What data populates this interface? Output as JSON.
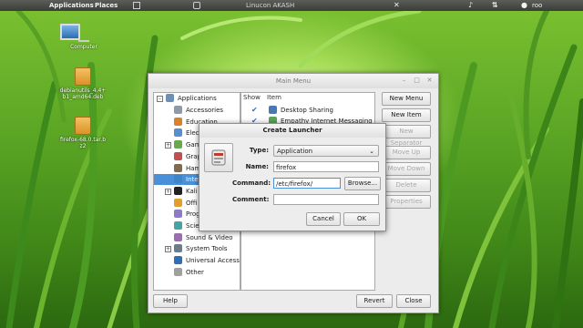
{
  "top_panel": {
    "applications": "Applications",
    "places": "Places",
    "window_title": "Linucon AKASH",
    "user": "roo"
  },
  "desktop": {
    "icons": [
      {
        "label": "Computer",
        "icon": "computer-icon"
      },
      {
        "label": "debianutils_4.4+b1_amd64.deb",
        "icon": "package-icon"
      },
      {
        "label": "firefox-68.0.tar.bz2",
        "icon": "archive-icon"
      }
    ]
  },
  "main_menu": {
    "title": "Main Menu",
    "categories_header": "Applications",
    "categories": [
      {
        "label": "Accessories",
        "color": "#8e9aa6"
      },
      {
        "label": "Education",
        "color": "#d9822b"
      },
      {
        "label": "Elec",
        "color": "#5a8fcf"
      },
      {
        "label": "Gam",
        "color": "#6aa84f"
      },
      {
        "label": "Grap",
        "color": "#c0504d"
      },
      {
        "label": "Ham",
        "color": "#7f6a52"
      },
      {
        "label": "Inte",
        "color": "#3d85c6"
      },
      {
        "label": "Kali",
        "color": "#222222"
      },
      {
        "label": "Offi",
        "color": "#e0a030"
      },
      {
        "label": "Prog",
        "color": "#8e7cc3"
      },
      {
        "label": "Scie",
        "color": "#4aa3a3"
      },
      {
        "label": "Sound & Video",
        "color": "#9a6fb0"
      },
      {
        "label": "System Tools",
        "color": "#6b7c8c"
      },
      {
        "label": "Universal Access",
        "color": "#2f6fb5"
      },
      {
        "label": "Other",
        "color": "#a0a0a0"
      }
    ],
    "columns": {
      "show": "Show",
      "item": "Item"
    },
    "items": [
      {
        "label": "Desktop Sharing",
        "checked": true,
        "color": "#4a78b5"
      },
      {
        "label": "Empathy Internet Messaging",
        "checked": true,
        "color": "#5fa35f"
      }
    ],
    "side_buttons": {
      "new_menu": "New Menu",
      "new_item": "New Item",
      "new_separator": "New Separator",
      "move_up": "Move Up",
      "move_down": "Move Down",
      "delete": "Delete",
      "properties": "Properties"
    },
    "help": "Help",
    "revert": "Revert",
    "close": "Close"
  },
  "create_launcher": {
    "title": "Create Launcher",
    "type_label": "Type:",
    "type_value": "Application",
    "name_label": "Name:",
    "name_value": "firefox",
    "command_label": "Command:",
    "command_value": "/etc/firefox/",
    "browse": "Browse...",
    "comment_label": "Comment:",
    "comment_value": "",
    "cancel": "Cancel",
    "ok": "OK"
  },
  "colors": {
    "selection": "#4a90d9",
    "accent_check": "#2a6fc9"
  }
}
